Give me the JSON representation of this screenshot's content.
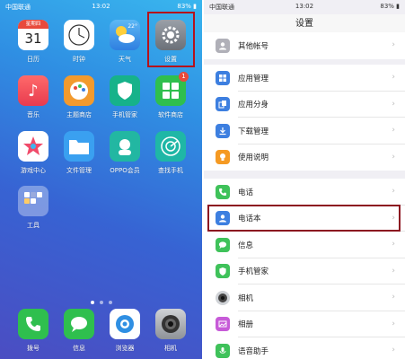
{
  "home": {
    "status": {
      "carrier": "中国联通",
      "time": "13:02",
      "battery": "83%"
    },
    "apps": [
      {
        "id": "calendar",
        "label": "日历",
        "icon": "calendar-icon",
        "weekday": "星期四",
        "day": "31"
      },
      {
        "id": "clock",
        "label": "时钟",
        "icon": "clock-icon"
      },
      {
        "id": "weather",
        "label": "天气",
        "icon": "weather-icon",
        "temp": "22°"
      },
      {
        "id": "settings",
        "label": "设置",
        "icon": "gear-icon"
      },
      {
        "id": "music",
        "label": "音乐",
        "icon": "music-note-icon"
      },
      {
        "id": "theme-store",
        "label": "主题商店",
        "icon": "palette-icon"
      },
      {
        "id": "phone-manager",
        "label": "手机管家",
        "icon": "shield-icon"
      },
      {
        "id": "app-store",
        "label": "软件商店",
        "icon": "app-grid-icon",
        "badge": "1"
      },
      {
        "id": "game-center",
        "label": "游戏中心",
        "icon": "game-star-icon"
      },
      {
        "id": "file-manager",
        "label": "文件管理",
        "icon": "folder-icon"
      },
      {
        "id": "oppo-member",
        "label": "OPPO会员",
        "icon": "member-icon"
      },
      {
        "id": "find-phone",
        "label": "查找手机",
        "icon": "radar-icon"
      },
      {
        "id": "tools",
        "label": "工具",
        "icon": "folder-tools-icon"
      }
    ],
    "dock": [
      {
        "id": "dialer",
        "label": "拨号",
        "icon": "phone-icon"
      },
      {
        "id": "messages",
        "label": "信息",
        "icon": "message-icon"
      },
      {
        "id": "browser",
        "label": "浏览器",
        "icon": "browser-icon"
      },
      {
        "id": "camera",
        "label": "相机",
        "icon": "camera-icon"
      }
    ],
    "page_indicator": {
      "pages": 3,
      "current": 1
    }
  },
  "settings": {
    "status": {
      "carrier": "中国联通",
      "time": "13:02",
      "battery": "83%"
    },
    "title": "设置",
    "groups": [
      [
        {
          "label": "其他帐号",
          "icon": "account-icon",
          "color": "#b0b0b8"
        }
      ],
      [
        {
          "label": "应用管理",
          "icon": "app-manage-icon",
          "color": "#3d7fe0"
        },
        {
          "label": "应用分身",
          "icon": "app-clone-icon",
          "color": "#3d7fe0"
        },
        {
          "label": "下载管理",
          "icon": "download-icon",
          "color": "#3d7fe0"
        },
        {
          "label": "使用说明",
          "icon": "bulb-icon",
          "color": "#f59a23"
        }
      ],
      [
        {
          "label": "电话",
          "icon": "phone-icon",
          "color": "#3fc25a"
        },
        {
          "label": "电话本",
          "icon": "contacts-icon",
          "color": "#3d7fe0"
        },
        {
          "label": "信息",
          "icon": "message-icon",
          "color": "#3fc25a"
        },
        {
          "label": "手机管家",
          "icon": "shield-icon",
          "color": "#3fc25a"
        },
        {
          "label": "相机",
          "icon": "camera-icon",
          "color": "#555555"
        },
        {
          "label": "相册",
          "icon": "gallery-icon",
          "color": "#c75bd8"
        },
        {
          "label": "语音助手",
          "icon": "voice-icon",
          "color": "#3fc25a"
        }
      ]
    ]
  }
}
